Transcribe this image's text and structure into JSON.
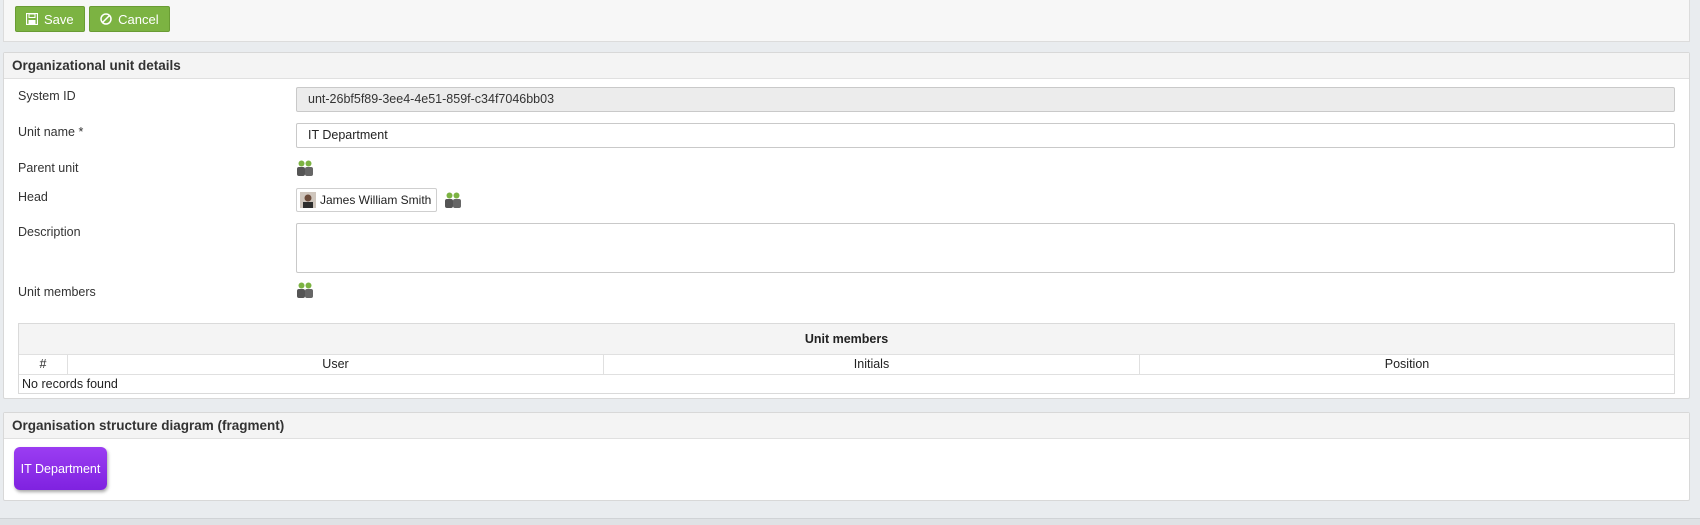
{
  "toolbar": {
    "save_label": "Save",
    "cancel_label": "Cancel"
  },
  "details": {
    "title": "Organizational unit details",
    "system_id": {
      "label": "System ID",
      "value": "unt-26bf5f89-3ee4-4e51-859f-c34f7046bb03"
    },
    "unit_name": {
      "label": "Unit name *",
      "value": "IT Department"
    },
    "parent_unit": {
      "label": "Parent unit"
    },
    "head": {
      "label": "Head",
      "value": "James William Smith"
    },
    "description": {
      "label": "Description",
      "value": ""
    },
    "unit_members": {
      "label": "Unit members"
    }
  },
  "members_table": {
    "title": "Unit members",
    "columns": [
      "#",
      "User",
      "Initials",
      "Position"
    ],
    "empty_text": "No records found"
  },
  "diagram": {
    "title": "Organisation structure diagram (fragment)",
    "node_label": "IT Department"
  },
  "colors": {
    "button_green": "#7cb342",
    "node_purple": "#8a2be2",
    "icon_green": "#7cb342"
  }
}
